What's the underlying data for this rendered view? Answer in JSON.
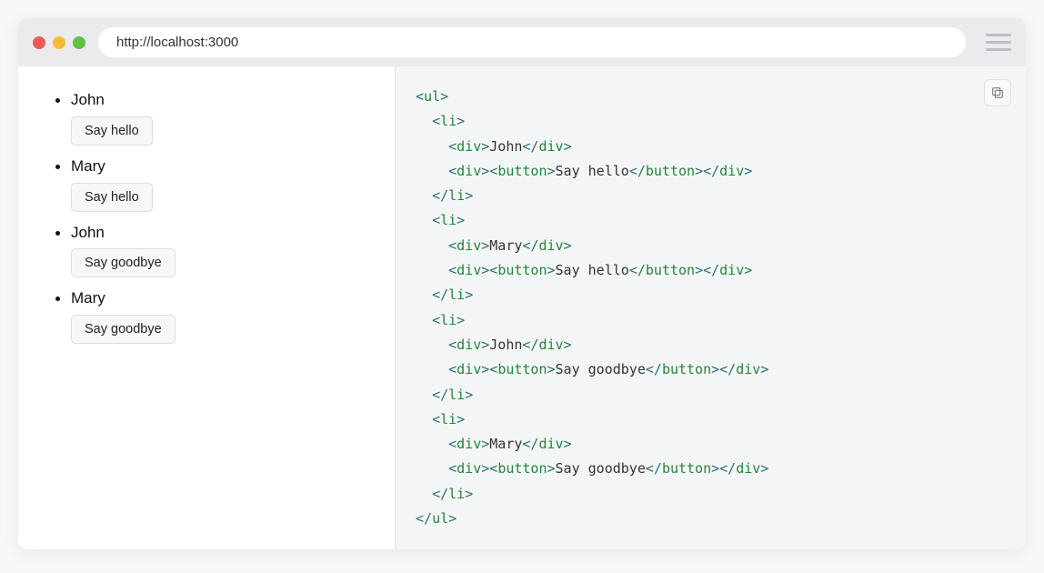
{
  "url": "http://localhost:3000",
  "list": [
    {
      "name": "John",
      "button": "Say hello"
    },
    {
      "name": "Mary",
      "button": "Say hello"
    },
    {
      "name": "John",
      "button": "Say goodbye"
    },
    {
      "name": "Mary",
      "button": "Say goodbye"
    }
  ],
  "code": {
    "lines": [
      [
        {
          "c": "p",
          "t": "<"
        },
        {
          "c": "t",
          "t": "ul"
        },
        {
          "c": "p",
          "t": ">"
        }
      ],
      [
        {
          "c": "tx",
          "t": "  "
        },
        {
          "c": "p",
          "t": "<"
        },
        {
          "c": "t",
          "t": "li"
        },
        {
          "c": "p",
          "t": ">"
        }
      ],
      [
        {
          "c": "tx",
          "t": "    "
        },
        {
          "c": "p",
          "t": "<"
        },
        {
          "c": "t",
          "t": "div"
        },
        {
          "c": "p",
          "t": ">"
        },
        {
          "c": "tx",
          "t": "John"
        },
        {
          "c": "p",
          "t": "</"
        },
        {
          "c": "t",
          "t": "div"
        },
        {
          "c": "p",
          "t": ">"
        }
      ],
      [
        {
          "c": "tx",
          "t": "    "
        },
        {
          "c": "p",
          "t": "<"
        },
        {
          "c": "t",
          "t": "div"
        },
        {
          "c": "p",
          "t": ">"
        },
        {
          "c": "p",
          "t": "<"
        },
        {
          "c": "t",
          "t": "button"
        },
        {
          "c": "p",
          "t": ">"
        },
        {
          "c": "tx",
          "t": "Say hello"
        },
        {
          "c": "p",
          "t": "</"
        },
        {
          "c": "t",
          "t": "button"
        },
        {
          "c": "p",
          "t": ">"
        },
        {
          "c": "p",
          "t": "</"
        },
        {
          "c": "t",
          "t": "div"
        },
        {
          "c": "p",
          "t": ">"
        }
      ],
      [
        {
          "c": "tx",
          "t": "  "
        },
        {
          "c": "p",
          "t": "</"
        },
        {
          "c": "t",
          "t": "li"
        },
        {
          "c": "p",
          "t": ">"
        }
      ],
      [
        {
          "c": "tx",
          "t": "  "
        },
        {
          "c": "p",
          "t": "<"
        },
        {
          "c": "t",
          "t": "li"
        },
        {
          "c": "p",
          "t": ">"
        }
      ],
      [
        {
          "c": "tx",
          "t": "    "
        },
        {
          "c": "p",
          "t": "<"
        },
        {
          "c": "t",
          "t": "div"
        },
        {
          "c": "p",
          "t": ">"
        },
        {
          "c": "tx",
          "t": "Mary"
        },
        {
          "c": "p",
          "t": "</"
        },
        {
          "c": "t",
          "t": "div"
        },
        {
          "c": "p",
          "t": ">"
        }
      ],
      [
        {
          "c": "tx",
          "t": "    "
        },
        {
          "c": "p",
          "t": "<"
        },
        {
          "c": "t",
          "t": "div"
        },
        {
          "c": "p",
          "t": ">"
        },
        {
          "c": "p",
          "t": "<"
        },
        {
          "c": "t",
          "t": "button"
        },
        {
          "c": "p",
          "t": ">"
        },
        {
          "c": "tx",
          "t": "Say hello"
        },
        {
          "c": "p",
          "t": "</"
        },
        {
          "c": "t",
          "t": "button"
        },
        {
          "c": "p",
          "t": ">"
        },
        {
          "c": "p",
          "t": "</"
        },
        {
          "c": "t",
          "t": "div"
        },
        {
          "c": "p",
          "t": ">"
        }
      ],
      [
        {
          "c": "tx",
          "t": "  "
        },
        {
          "c": "p",
          "t": "</"
        },
        {
          "c": "t",
          "t": "li"
        },
        {
          "c": "p",
          "t": ">"
        }
      ],
      [
        {
          "c": "tx",
          "t": "  "
        },
        {
          "c": "p",
          "t": "<"
        },
        {
          "c": "t",
          "t": "li"
        },
        {
          "c": "p",
          "t": ">"
        }
      ],
      [
        {
          "c": "tx",
          "t": "    "
        },
        {
          "c": "p",
          "t": "<"
        },
        {
          "c": "t",
          "t": "div"
        },
        {
          "c": "p",
          "t": ">"
        },
        {
          "c": "tx",
          "t": "John"
        },
        {
          "c": "p",
          "t": "</"
        },
        {
          "c": "t",
          "t": "div"
        },
        {
          "c": "p",
          "t": ">"
        }
      ],
      [
        {
          "c": "tx",
          "t": "    "
        },
        {
          "c": "p",
          "t": "<"
        },
        {
          "c": "t",
          "t": "div"
        },
        {
          "c": "p",
          "t": ">"
        },
        {
          "c": "p",
          "t": "<"
        },
        {
          "c": "t",
          "t": "button"
        },
        {
          "c": "p",
          "t": ">"
        },
        {
          "c": "tx",
          "t": "Say goodbye"
        },
        {
          "c": "p",
          "t": "</"
        },
        {
          "c": "t",
          "t": "button"
        },
        {
          "c": "p",
          "t": ">"
        },
        {
          "c": "p",
          "t": "</"
        },
        {
          "c": "t",
          "t": "div"
        },
        {
          "c": "p",
          "t": ">"
        }
      ],
      [
        {
          "c": "tx",
          "t": "  "
        },
        {
          "c": "p",
          "t": "</"
        },
        {
          "c": "t",
          "t": "li"
        },
        {
          "c": "p",
          "t": ">"
        }
      ],
      [
        {
          "c": "tx",
          "t": "  "
        },
        {
          "c": "p",
          "t": "<"
        },
        {
          "c": "t",
          "t": "li"
        },
        {
          "c": "p",
          "t": ">"
        }
      ],
      [
        {
          "c": "tx",
          "t": "    "
        },
        {
          "c": "p",
          "t": "<"
        },
        {
          "c": "t",
          "t": "div"
        },
        {
          "c": "p",
          "t": ">"
        },
        {
          "c": "tx",
          "t": "Mary"
        },
        {
          "c": "p",
          "t": "</"
        },
        {
          "c": "t",
          "t": "div"
        },
        {
          "c": "p",
          "t": ">"
        }
      ],
      [
        {
          "c": "tx",
          "t": "    "
        },
        {
          "c": "p",
          "t": "<"
        },
        {
          "c": "t",
          "t": "div"
        },
        {
          "c": "p",
          "t": ">"
        },
        {
          "c": "p",
          "t": "<"
        },
        {
          "c": "t",
          "t": "button"
        },
        {
          "c": "p",
          "t": ">"
        },
        {
          "c": "tx",
          "t": "Say goodbye"
        },
        {
          "c": "p",
          "t": "</"
        },
        {
          "c": "t",
          "t": "button"
        },
        {
          "c": "p",
          "t": ">"
        },
        {
          "c": "p",
          "t": "</"
        },
        {
          "c": "t",
          "t": "div"
        },
        {
          "c": "p",
          "t": ">"
        }
      ],
      [
        {
          "c": "tx",
          "t": "  "
        },
        {
          "c": "p",
          "t": "</"
        },
        {
          "c": "t",
          "t": "li"
        },
        {
          "c": "p",
          "t": ">"
        }
      ],
      [
        {
          "c": "p",
          "t": "</"
        },
        {
          "c": "t",
          "t": "ul"
        },
        {
          "c": "p",
          "t": ">"
        }
      ]
    ]
  }
}
